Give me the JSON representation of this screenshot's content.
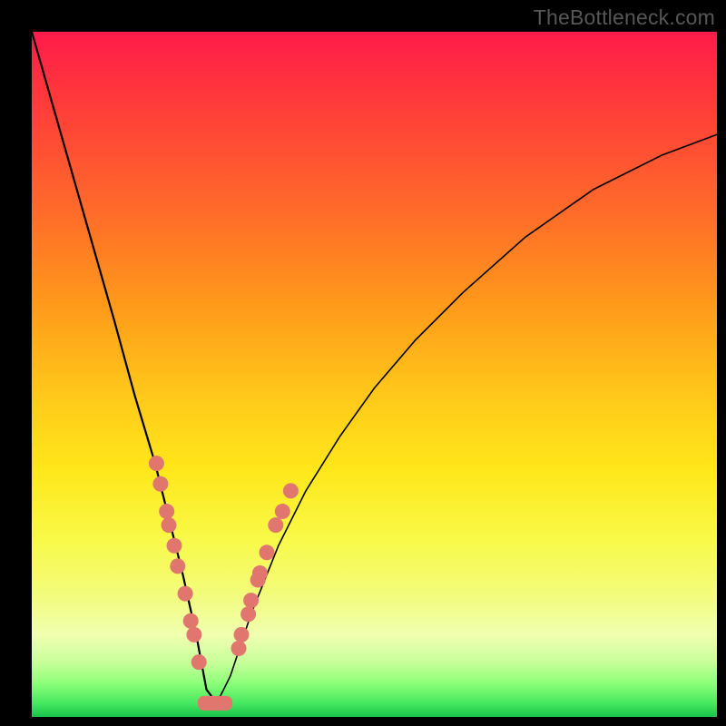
{
  "watermark": "TheBottleneck.com",
  "chart_data": {
    "type": "line",
    "title": "",
    "xlabel": "",
    "ylabel": "",
    "xlim": [
      0,
      100
    ],
    "ylim": [
      0,
      100
    ],
    "grid": false,
    "legend": false,
    "series": [
      {
        "name": "bottleneck-curve",
        "x": [
          0,
          4,
          8,
          12,
          15,
          18,
          20,
          22,
          24,
          25.5,
          27,
          29,
          32,
          36,
          40,
          45,
          50,
          56,
          63,
          72,
          82,
          92,
          100
        ],
        "y": [
          100,
          86,
          72,
          58,
          47,
          37,
          29,
          21,
          12,
          4,
          2,
          6,
          15,
          25,
          33,
          41,
          48,
          55,
          62,
          70,
          77,
          82,
          85
        ]
      }
    ],
    "markers": {
      "name": "highlighted-points",
      "color": "#e1766f",
      "points": [
        {
          "x": 18.2,
          "y": 37
        },
        {
          "x": 18.8,
          "y": 34
        },
        {
          "x": 19.7,
          "y": 30
        },
        {
          "x": 20.0,
          "y": 28
        },
        {
          "x": 20.8,
          "y": 25
        },
        {
          "x": 21.3,
          "y": 22
        },
        {
          "x": 22.4,
          "y": 18
        },
        {
          "x": 23.2,
          "y": 14
        },
        {
          "x": 23.7,
          "y": 12
        },
        {
          "x": 24.4,
          "y": 8
        },
        {
          "x": 30.2,
          "y": 10
        },
        {
          "x": 30.6,
          "y": 12
        },
        {
          "x": 31.6,
          "y": 15
        },
        {
          "x": 32.0,
          "y": 17
        },
        {
          "x": 33.0,
          "y": 20
        },
        {
          "x": 33.3,
          "y": 21
        },
        {
          "x": 34.3,
          "y": 24
        },
        {
          "x": 35.6,
          "y": 28
        },
        {
          "x": 36.6,
          "y": 30
        },
        {
          "x": 37.8,
          "y": 33
        }
      ],
      "base_segment": {
        "x_start": 25.0,
        "x_end": 28.5,
        "y": 2
      }
    }
  }
}
